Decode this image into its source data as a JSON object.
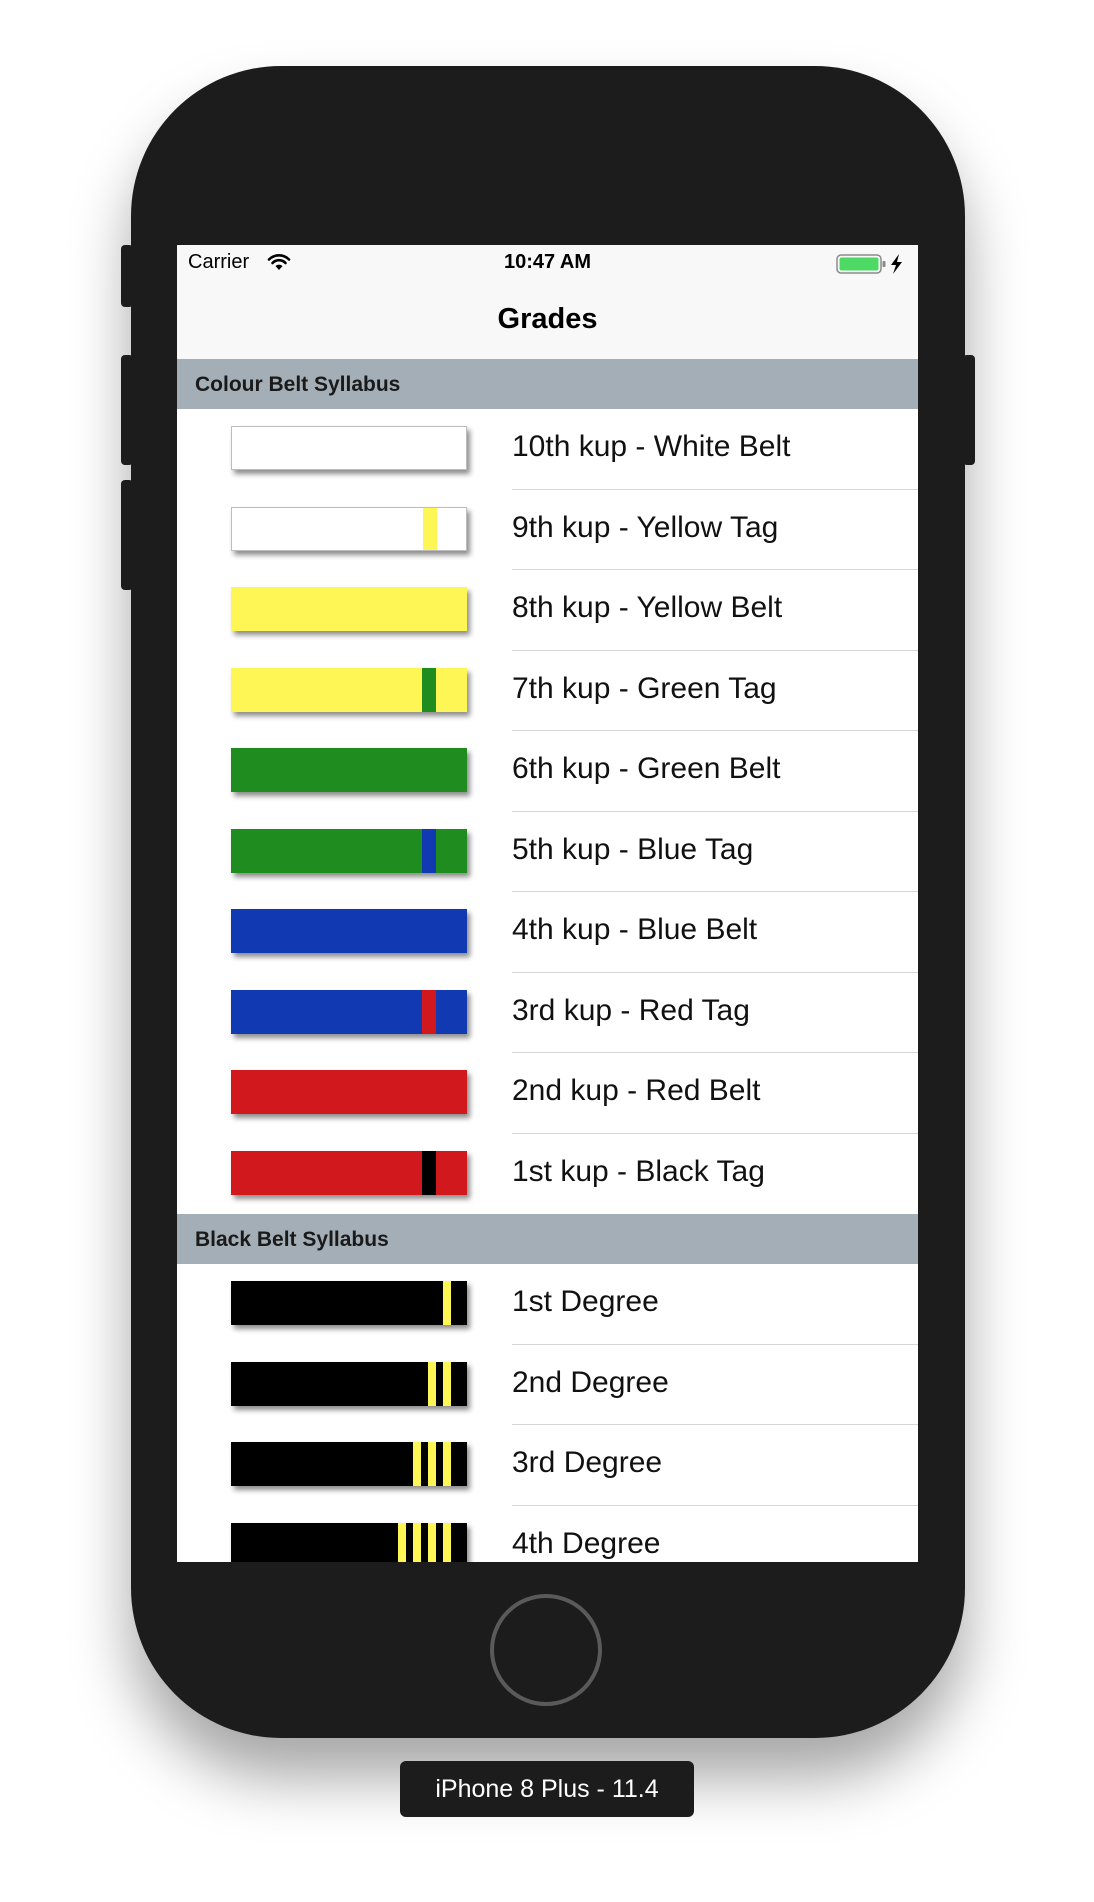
{
  "status_bar": {
    "carrier": "Carrier",
    "time": "10:47 AM"
  },
  "nav": {
    "title": "Grades"
  },
  "sections": [
    {
      "header": "Colour Belt Syllabus",
      "rows": [
        {
          "label": "10th kup - White Belt",
          "belt_color": "#ffffff",
          "tag_color": null
        },
        {
          "label": "9th kup - Yellow Tag",
          "belt_color": "#ffffff",
          "tag_color": "#fdf654"
        },
        {
          "label": "8th kup - Yellow Belt",
          "belt_color": "#fdf654",
          "tag_color": null
        },
        {
          "label": "7th kup - Green Tag",
          "belt_color": "#fdf654",
          "tag_color": "#1f8c1f"
        },
        {
          "label": "6th kup - Green Belt",
          "belt_color": "#1f8c1f",
          "tag_color": null
        },
        {
          "label": "5th kup - Blue Tag",
          "belt_color": "#1f8c1f",
          "tag_color": "#1139b1"
        },
        {
          "label": "4th kup - Blue Belt",
          "belt_color": "#1139b1",
          "tag_color": null
        },
        {
          "label": "3rd kup - Red Tag",
          "belt_color": "#1139b1",
          "tag_color": "#d0181d"
        },
        {
          "label": "2nd kup - Red Belt",
          "belt_color": "#d0181d",
          "tag_color": null
        },
        {
          "label": "1st kup - Black Tag",
          "belt_color": "#d0181d",
          "tag_color": "#000000"
        }
      ]
    },
    {
      "header": "Black Belt Syllabus",
      "rows": [
        {
          "label": "1st Degree",
          "belt_color": "#000000",
          "degrees": 1
        },
        {
          "label": "2nd Degree",
          "belt_color": "#000000",
          "degrees": 2
        },
        {
          "label": "3rd Degree",
          "belt_color": "#000000",
          "degrees": 3
        },
        {
          "label": "4th Degree",
          "belt_color": "#000000",
          "degrees": 4
        }
      ]
    }
  ],
  "device_label": "iPhone 8 Plus - 11.4",
  "colors": {
    "section_header_bg": "#a4aeb6",
    "degree_stripe": "#fdf654",
    "battery": "#4cd964"
  },
  "icons": [
    "wifi-icon",
    "battery-icon",
    "charging-bolt-icon"
  ]
}
